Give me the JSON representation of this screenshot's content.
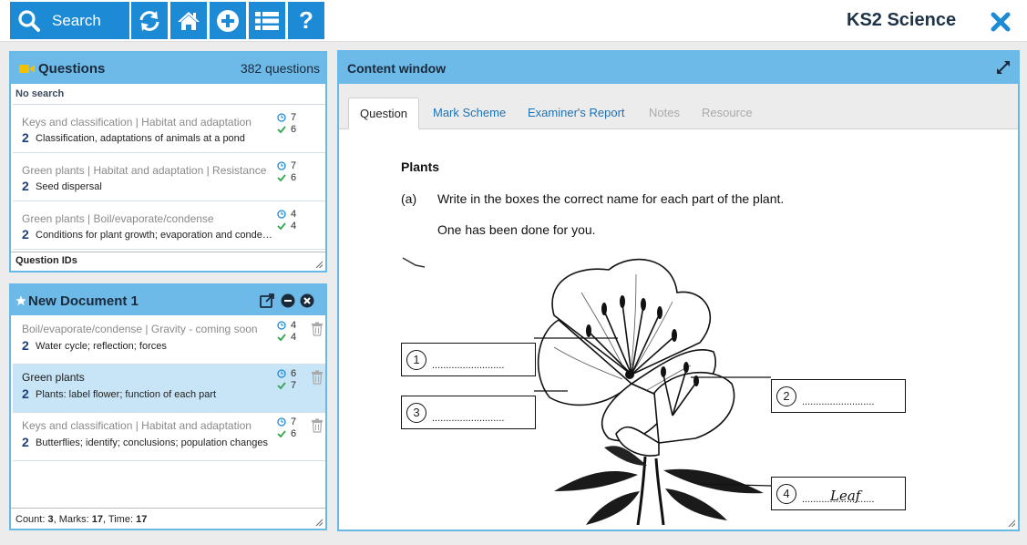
{
  "toolbar": {
    "search_label": "Search",
    "buttons": [
      "refresh-icon",
      "home-icon",
      "add-icon",
      "list-icon",
      "help-icon"
    ],
    "help_glyph": "?",
    "app_title": "KS2 Science"
  },
  "colors": {
    "accent": "#1d8ad6",
    "panel_header": "#6dbae9",
    "selected_row": "#c8e5f7",
    "tick": "#2ea84a"
  },
  "questions": {
    "title": "Questions",
    "count_text": "382 questions",
    "filter_status": "No search",
    "items": [
      {
        "topic": "Keys and classification | Habitat and adaptation",
        "marks_num": "2",
        "desc": "Classification, adaptations of animals at a pond",
        "time": "7",
        "marks": "6"
      },
      {
        "topic": "Green plants | Habitat and adaptation | Resistance",
        "marks_num": "2",
        "desc": "Seed dispersal",
        "time": "7",
        "marks": "6"
      },
      {
        "topic": "Green plants | Boil/evaporate/condense",
        "marks_num": "2",
        "desc": "Conditions for plant growth; evaporation and condensation",
        "time": "4",
        "marks": "4"
      }
    ],
    "footer": "Question IDs"
  },
  "document": {
    "title": "New Document 1",
    "items": [
      {
        "topic": "Boil/evaporate/condense | Gravity - coming soon",
        "marks_num": "2",
        "desc": "Water cycle; reflection; forces",
        "time": "4",
        "marks": "4"
      },
      {
        "topic": "Green plants",
        "marks_num": "2",
        "desc": "Plants: label flower; function of each part",
        "time": "6",
        "marks": "7"
      },
      {
        "topic": "Keys and classification | Habitat and adaptation",
        "marks_num": "2",
        "desc": "Butterflies; identify; conclusions; population changes",
        "time": "7",
        "marks": "6"
      }
    ],
    "footer": {
      "count_label": "Count: ",
      "count": "3",
      "marks_label": ", Marks: ",
      "marks": "17",
      "time_label": ", Time: ",
      "time": "17"
    }
  },
  "content": {
    "title": "Content window",
    "tabs": [
      {
        "label": "Question",
        "state": "active"
      },
      {
        "label": "Mark Scheme",
        "state": "link"
      },
      {
        "label": "Examiner's Report",
        "state": "link"
      },
      {
        "label": "Notes",
        "state": "disabled"
      },
      {
        "label": "Resource",
        "state": "disabled"
      }
    ],
    "heading": "Plants",
    "part": "(a)",
    "instruction": "Write in the boxes the correct name for each part of the plant.",
    "note": "One has been done for you.",
    "labels": [
      {
        "num": "1",
        "dots": "..........................",
        "answer": ""
      },
      {
        "num": "2",
        "dots": "..........................",
        "answer": ""
      },
      {
        "num": "3",
        "dots": "..........................",
        "answer": ""
      },
      {
        "num": "4",
        "dots": "..........................",
        "answer": "Leaf"
      }
    ]
  }
}
